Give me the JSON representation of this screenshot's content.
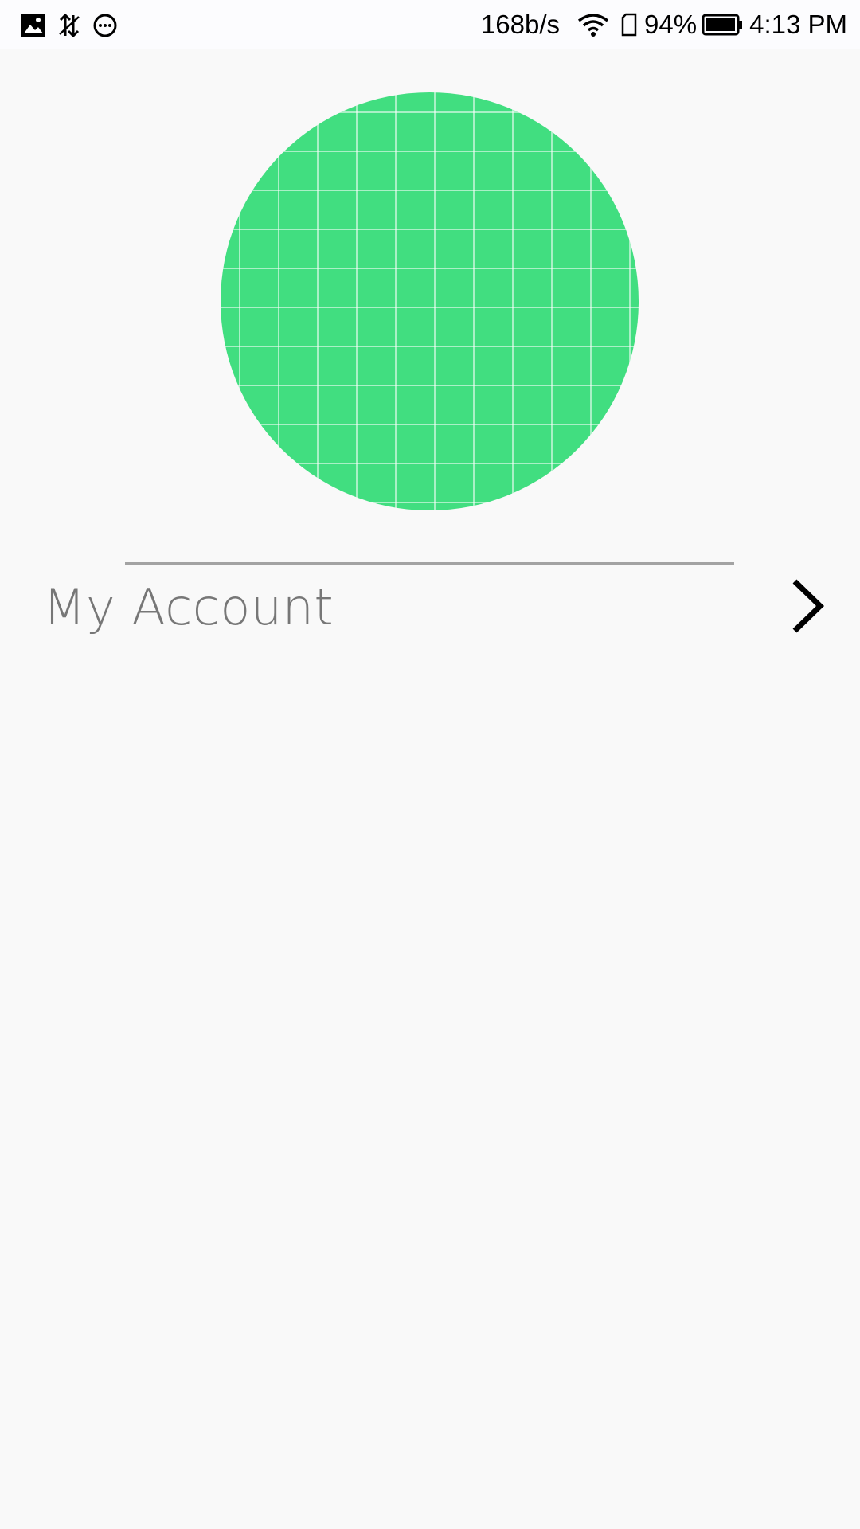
{
  "status_bar": {
    "net_speed": "168b/s",
    "battery_percent": "94%",
    "time": "4:13 PM",
    "battery_level": 94,
    "left_icons": [
      "image-icon",
      "data-sync-icon",
      "chat-bubble-icon"
    ],
    "right_icons": [
      "wifi-icon",
      "sim-card-icon",
      "battery-icon"
    ]
  },
  "profile": {
    "avatar_color": "#41de80"
  },
  "menu": {
    "account_label": "My Account",
    "account_icon": "chevron-right-icon"
  },
  "colors": {
    "background": "#f9f9f9",
    "label": "#777777",
    "divider": "#a3a3a3"
  }
}
